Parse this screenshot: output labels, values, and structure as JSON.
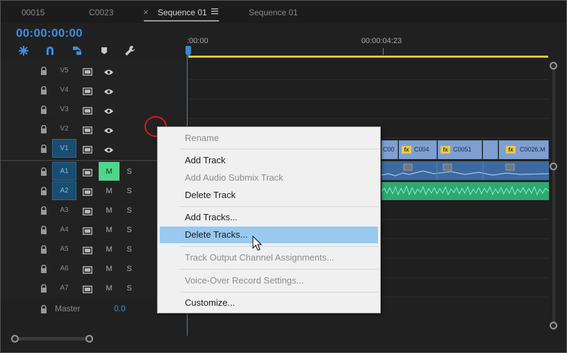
{
  "tabs": [
    {
      "label": "00015"
    },
    {
      "label": "C0023"
    },
    {
      "label": "Sequence 01",
      "active": true,
      "close_icon": "close-icon",
      "menu_icon": "hamburger-icon"
    },
    {
      "label": "Sequence 01"
    }
  ],
  "header": {
    "timecode": "00:00:00:00",
    "tools": [
      "snap-icon",
      "magnet-icon",
      "linked-selection-icon",
      "marker-icon",
      "wrench-icon"
    ],
    "accent": "#3d8ee0"
  },
  "ruler": {
    "start_label": ":00:00",
    "mid_label": "00:00:04:23"
  },
  "tracks": {
    "video": [
      {
        "name": "V5",
        "selected": false
      },
      {
        "name": "V4",
        "selected": false
      },
      {
        "name": "V3",
        "selected": false
      },
      {
        "name": "V2",
        "selected": false
      },
      {
        "name": "V1",
        "selected": true
      }
    ],
    "audio": [
      {
        "name": "A1",
        "selected": true,
        "m": "M",
        "s": "S",
        "muted": true
      },
      {
        "name": "A2",
        "selected": true,
        "m": "M",
        "s": "S",
        "muted": false
      },
      {
        "name": "A3",
        "selected": false,
        "m": "M",
        "s": "S",
        "muted": false
      },
      {
        "name": "A4",
        "selected": false,
        "m": "M",
        "s": "S",
        "muted": false
      },
      {
        "name": "A5",
        "selected": false,
        "m": "M",
        "s": "S",
        "muted": false
      },
      {
        "name": "A6",
        "selected": false,
        "m": "M",
        "s": "S",
        "muted": false
      },
      {
        "name": "A7",
        "selected": false,
        "m": "M",
        "s": "S",
        "muted": false
      }
    ],
    "master": {
      "label": "Master",
      "value": "0.0"
    }
  },
  "clips": {
    "video": [
      {
        "label": "C00"
      },
      {
        "label": "C004"
      },
      {
        "label": "C0051"
      },
      {
        "label": "C0026.M"
      }
    ],
    "fx_badge": "fx"
  },
  "context_menu": {
    "items": [
      {
        "label": "Rename",
        "disabled": true
      },
      {
        "label": "Add Track",
        "disabled": false
      },
      {
        "label": "Add Audio Submix Track",
        "disabled": true
      },
      {
        "label": "Delete Track",
        "disabled": false
      },
      {
        "label": "Add Tracks...",
        "disabled": false
      },
      {
        "label": "Delete Tracks...",
        "disabled": false,
        "highlighted": true
      },
      {
        "label": "Track Output Channel Assignments...",
        "disabled": true
      },
      {
        "label": "Voice-Over Record Settings...",
        "disabled": true
      },
      {
        "label": "Customize...",
        "disabled": false
      }
    ]
  },
  "colors": {
    "menu_highlight": "#99c9ef",
    "selected_track": "#1a4d72",
    "mute_on": "#4fd68a",
    "workarea": "#d9c94a",
    "playhead": "#3b86d6"
  }
}
